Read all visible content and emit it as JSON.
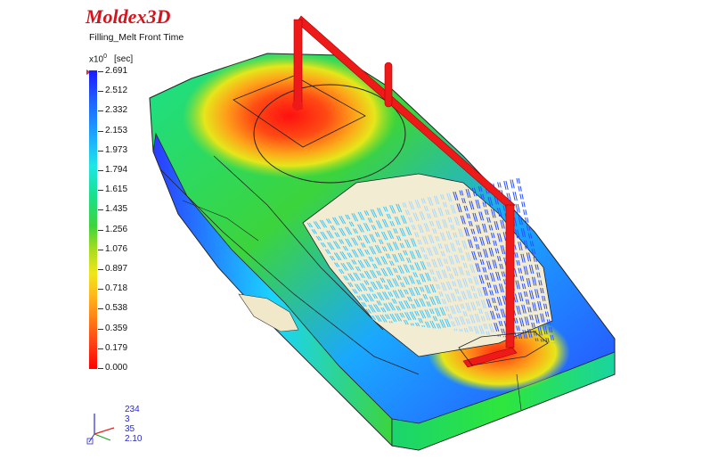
{
  "app": {
    "logo": "Moldex3D",
    "result_title": "Filling_Melt Front Time"
  },
  "legend": {
    "scale_prefix": "x10",
    "scale_exponent": "0",
    "unit": "[sec]",
    "values": [
      "2.691",
      "2.512",
      "2.332",
      "2.153",
      "1.973",
      "1.794",
      "1.615",
      "1.435",
      "1.256",
      "1.076",
      "0.897",
      "0.718",
      "0.538",
      "0.359",
      "0.179",
      "0.000"
    ]
  },
  "triad": {
    "lines": [
      "234",
      "3",
      "35",
      "2.10"
    ]
  },
  "colors": {
    "logo": "#d4141c",
    "runner": "#ee1a1a",
    "hot": "#ff2a10",
    "cold": "#1a2aff"
  },
  "icons": {
    "axis_triad": "xyz-axis-icon",
    "legend_marker": "triangle-marker-icon"
  }
}
